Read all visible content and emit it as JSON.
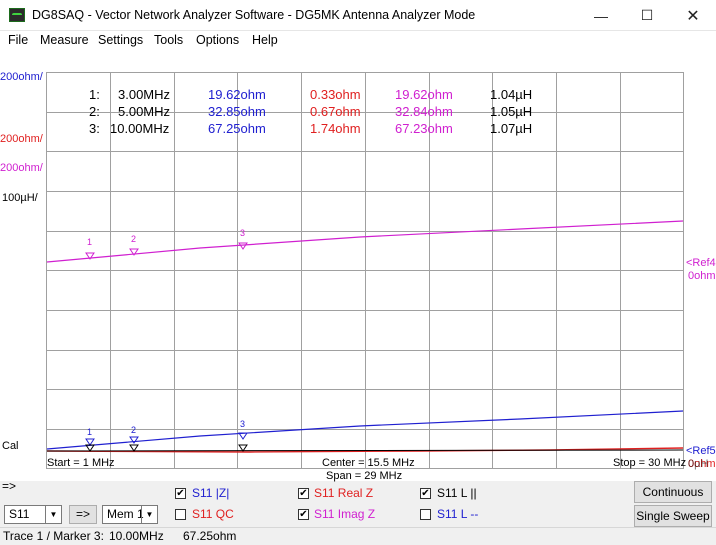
{
  "window": {
    "title": "DG8SAQ  -  Vector Network Analyzer Software - DG5MK Antenna Analyzer Mode"
  },
  "menu": [
    "File",
    "Measure",
    "Settings",
    "Tools",
    "Options",
    "Help"
  ],
  "plot": {
    "scale_labels": {
      "z": "200ohm/",
      "real": "200ohm/",
      "imag": "200ohm/",
      "ind": "100µH/"
    },
    "cal": "Cal",
    "ref4_a": "<Ref4",
    "ref4_b": "0ohm",
    "ref5_a": "<Ref5",
    "ref5_b": "0ohm",
    "ref5_c": "0µH",
    "start": "Start = 1 MHz",
    "center": "Center = 15.5 MHz",
    "span": "Span = 29 MHz",
    "stop": "Stop = 30 MHz",
    "marker_ids": [
      "1",
      "2",
      "3"
    ],
    "markers": [
      {
        "id": "1:",
        "freq": "3.00MHz",
        "z": "19.62ohm",
        "real": "0.33ohm",
        "imag": "19.62ohm",
        "ind": "1.04µH"
      },
      {
        "id": "2:",
        "freq": "5.00MHz",
        "z": "32.85ohm",
        "real": "0.67ohm",
        "imag": "32.84ohm",
        "ind": "1.05µH"
      },
      {
        "id": "3:",
        "freq": "10.00MHz",
        "z": "67.25ohm",
        "real": "1.74ohm",
        "imag": "67.23ohm",
        "ind": "1.07µH"
      }
    ]
  },
  "controls": {
    "arrow": "=>",
    "param_select": "S11",
    "copy_button": "=>",
    "mem_select": "Mem 1",
    "continuous": "Continuous",
    "single_sweep": "Single Sweep",
    "traces": [
      {
        "label": "S11  |Z|",
        "checked": true,
        "color": "#2020d0"
      },
      {
        "label": "S11  QC",
        "checked": false,
        "color": "#e02020"
      },
      {
        "label": "S11  Real Z",
        "checked": true,
        "color": "#e02020"
      },
      {
        "label": "S11  Imag Z",
        "checked": true,
        "color": "#d020d0"
      },
      {
        "label": "S11  L ||",
        "checked": true,
        "color": "#000000"
      },
      {
        "label": "S11  L --",
        "checked": false,
        "color": "#2020d0"
      }
    ]
  },
  "status": {
    "trace": "Trace 1 / Marker 3:",
    "freq": "10.00MHz",
    "value": "67.25ohm"
  },
  "colors": {
    "z": "#2020d0",
    "real": "#e02020",
    "imag": "#d020d0",
    "ind": "#000000",
    "grid": "#a0a0a0"
  }
}
